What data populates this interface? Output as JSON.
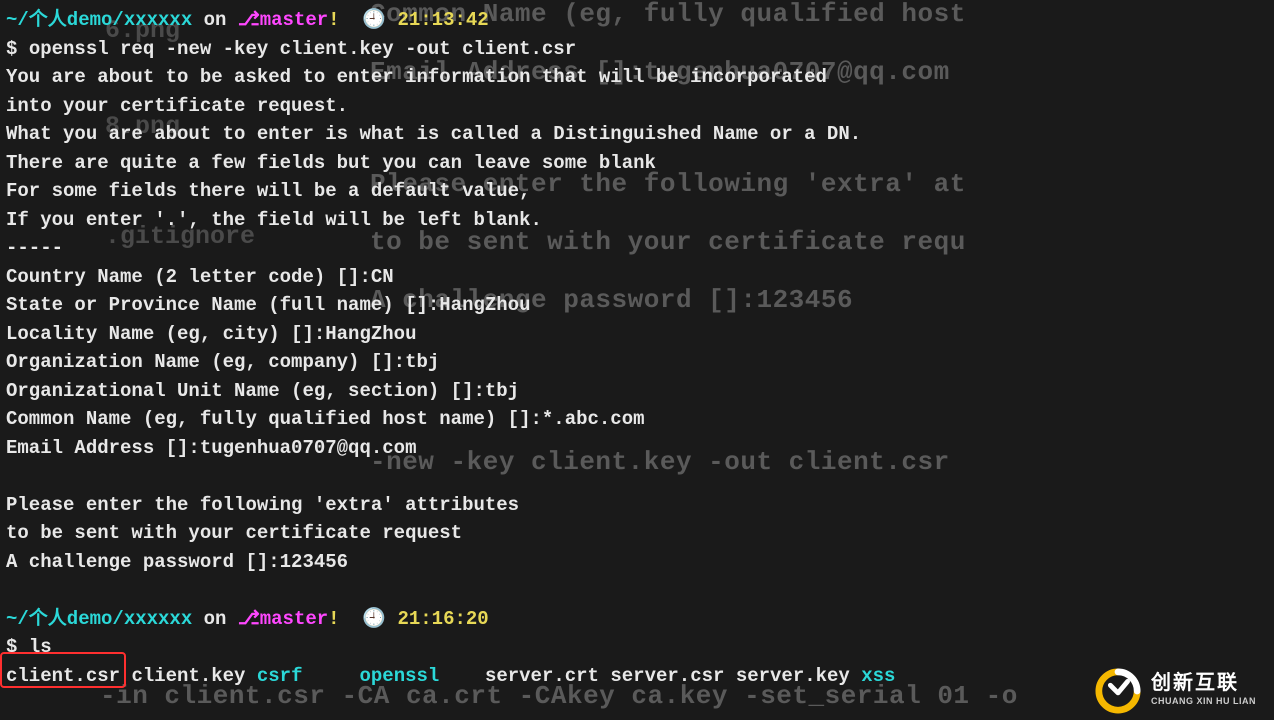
{
  "ghost_lines": {
    "l1": "Common Name (eg, fully qualified host",
    "l2": "Email Address []:tugenhua0707@qq.com",
    "l3": "Please enter the following 'extra' at",
    "l4": "to be sent with your certificate requ",
    "l5": "A challenge password []:123456",
    "l6": "-new -key client.key -out client.csr",
    "l7": "-in client.csr -CA ca.crt -CAkey ca.key -set_serial 01 -o"
  },
  "ghost_side": {
    "a": "6.png",
    "b": "8.png",
    "c": ".gitignore"
  },
  "block1": {
    "prompt_path": "~/个人demo/xxxxxx",
    "on": " on ",
    "branch": "master",
    "bang": "!",
    "time": "21:13:42",
    "cmd_prefix": "$ ",
    "cmd": "openssl req -new -key client.key -out client.csr",
    "out1": "You are about to be asked to enter information that will be incorporated",
    "out2": "into your certificate request.",
    "out3": "What you are about to enter is what is called a Distinguished Name or a DN.",
    "out4": "There are quite a few fields but you can leave some blank",
    "out5": "For some fields there will be a default value,",
    "out6": "If you enter '.', the field will be left blank.",
    "out7": "-----",
    "cn": "Country Name (2 letter code) []:CN",
    "st": "State or Province Name (full name) []:HangZhou",
    "loc": "Locality Name (eg, city) []:HangZhou",
    "org": "Organization Name (eg, company) []:tbj",
    "ou": "Organizational Unit Name (eg, section) []:tbj",
    "common": "Common Name (eg, fully qualified host name) []:*.abc.com",
    "email": "Email Address []:tugenhua0707@qq.com",
    "extra1": "Please enter the following 'extra' attributes",
    "extra2": "to be sent with your certificate request",
    "extra3": "A challenge password []:123456"
  },
  "block2": {
    "prompt_path": "~/个人demo/xxxxxx",
    "on": " on ",
    "branch": "master",
    "bang": "!",
    "time": "21:16:20",
    "cmd_prefix": "$ ",
    "cmd": "ls",
    "files": {
      "f1": "client.csr",
      "f2": "client.key",
      "f3": "csrf",
      "f4": "openssl",
      "f5": "server.crt",
      "f6": "server.csr",
      "f7": "server.key",
      "f8": "xss"
    }
  },
  "glyphs": {
    "branch": "⎇",
    "clock": "🕘"
  },
  "watermark": {
    "big": "创新互联",
    "small": "CHUANG XIN HU LIAN"
  }
}
